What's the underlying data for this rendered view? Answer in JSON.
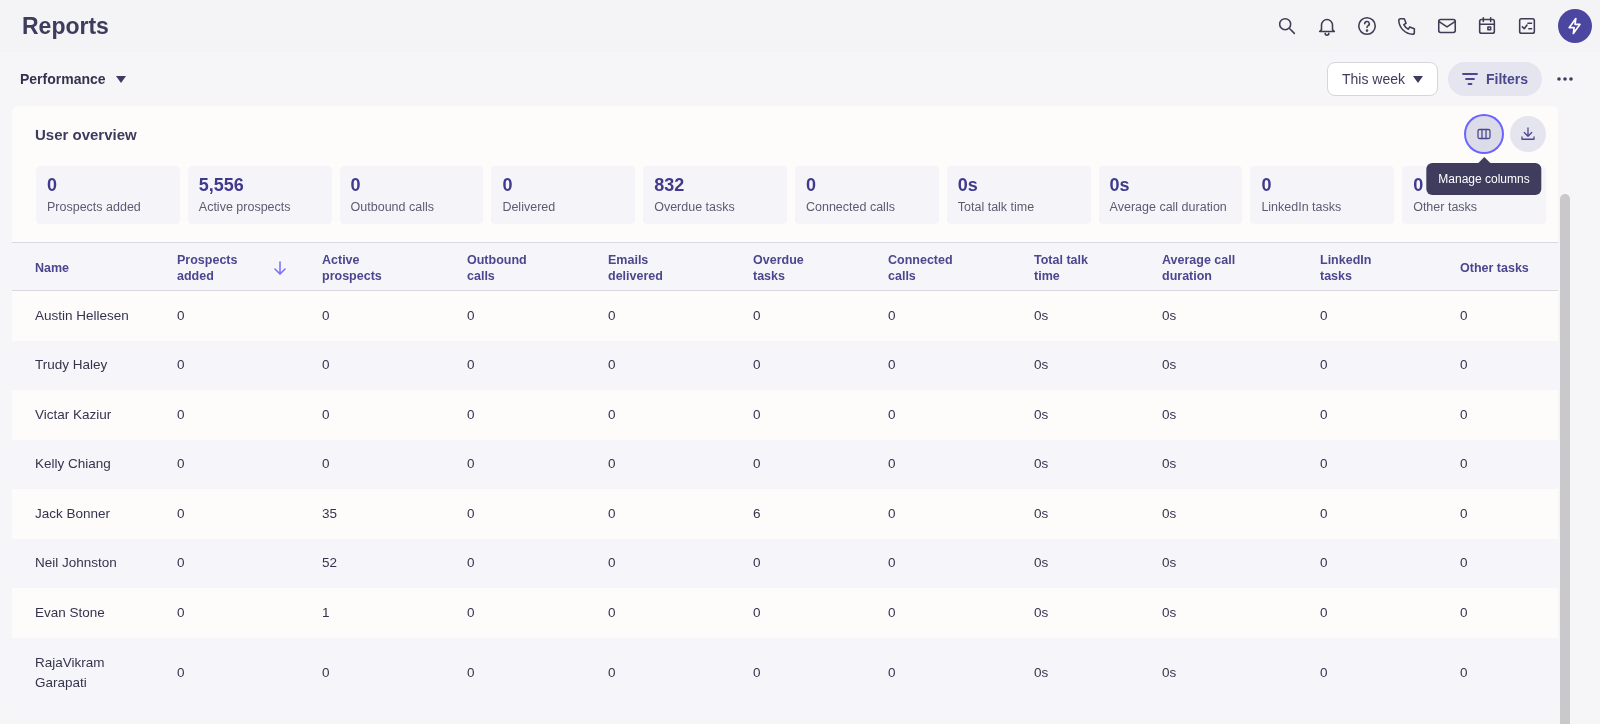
{
  "page_title": "Reports",
  "header_icons": [
    {
      "kind": "search"
    },
    {
      "kind": "bell"
    },
    {
      "kind": "help"
    },
    {
      "kind": "phone"
    },
    {
      "kind": "mail"
    },
    {
      "kind": "calendar"
    },
    {
      "kind": "tasks"
    },
    {
      "kind": "bolt"
    }
  ],
  "report_selector": {
    "label": "Performance"
  },
  "date_range": {
    "value": "This week"
  },
  "filters_button": {
    "label": "Filters"
  },
  "card": {
    "title": "User overview",
    "actions": [
      {
        "kind": "columns",
        "active": true,
        "tooltip": "Manage columns"
      },
      {
        "kind": "download",
        "active": false
      }
    ],
    "stats": [
      {
        "value": "0",
        "label": "Prospects added"
      },
      {
        "value": "5,556",
        "label": "Active prospects"
      },
      {
        "value": "0",
        "label": "Outbound calls"
      },
      {
        "value": "0",
        "label": "Delivered"
      },
      {
        "value": "832",
        "label": "Overdue tasks"
      },
      {
        "value": "0",
        "label": "Connected calls"
      },
      {
        "value": "0s",
        "label": "Total talk time"
      },
      {
        "value": "0s",
        "label": "Average call duration"
      },
      {
        "value": "0",
        "label": "LinkedIn tasks"
      },
      {
        "value": "0",
        "label": "Other tasks"
      }
    ]
  },
  "table": {
    "columns": [
      {
        "label": "Name",
        "sorted": false
      },
      {
        "label": "Prospects added",
        "sorted": true
      },
      {
        "label": "Active prospects",
        "sorted": false
      },
      {
        "label": "Outbound calls",
        "sorted": false
      },
      {
        "label": "Emails delivered",
        "sorted": false
      },
      {
        "label": "Overdue tasks",
        "sorted": false
      },
      {
        "label": "Connected calls",
        "sorted": false
      },
      {
        "label": "Total talk time",
        "sorted": false
      },
      {
        "label": "Average call duration",
        "sorted": false
      },
      {
        "label": "LinkedIn tasks",
        "sorted": false
      },
      {
        "label": "Other tasks",
        "sorted": false
      }
    ],
    "rows": [
      [
        "Austin Hellesen",
        "0",
        "0",
        "0",
        "0",
        "0",
        "0",
        "0s",
        "0s",
        "0",
        "0"
      ],
      [
        "Trudy Haley",
        "0",
        "0",
        "0",
        "0",
        "0",
        "0",
        "0s",
        "0s",
        "0",
        "0"
      ],
      [
        "Victar Kaziur",
        "0",
        "0",
        "0",
        "0",
        "0",
        "0",
        "0s",
        "0s",
        "0",
        "0"
      ],
      [
        "Kelly Chiang",
        "0",
        "0",
        "0",
        "0",
        "0",
        "0",
        "0s",
        "0s",
        "0",
        "0"
      ],
      [
        "Jack Bonner",
        "0",
        "35",
        "0",
        "0",
        "6",
        "0",
        "0s",
        "0s",
        "0",
        "0"
      ],
      [
        "Neil Johnston",
        "0",
        "52",
        "0",
        "0",
        "0",
        "0",
        "0s",
        "0s",
        "0",
        "0"
      ],
      [
        "Evan Stone",
        "0",
        "1",
        "0",
        "0",
        "0",
        "0",
        "0s",
        "0s",
        "0",
        "0"
      ],
      [
        "RajaVikram Garapati",
        "0",
        "0",
        "0",
        "0",
        "0",
        "0",
        "0s",
        "0s",
        "0",
        "0"
      ]
    ]
  }
}
